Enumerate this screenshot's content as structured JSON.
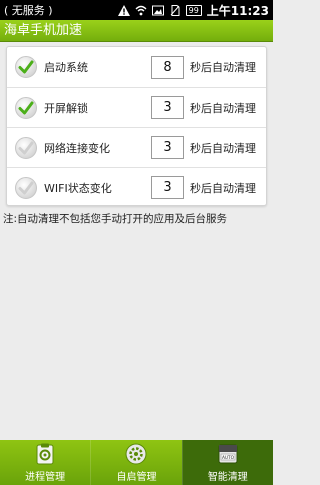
{
  "status_bar": {
    "carrier": "( 无服务 )",
    "battery": "99",
    "time": "上午11:23"
  },
  "title": "海卓手机加速",
  "settings": [
    {
      "label": "启动系统",
      "seconds": "8",
      "suffix": "秒后自动清理",
      "checked": true
    },
    {
      "label": "开屏解锁",
      "seconds": "3",
      "suffix": "秒后自动清理",
      "checked": true
    },
    {
      "label": "网络连接变化",
      "seconds": "3",
      "suffix": "秒后自动清理",
      "checked": false
    },
    {
      "label": "WIFI状态变化",
      "seconds": "3",
      "suffix": "秒后自动清理",
      "checked": false
    }
  ],
  "note": "注:自动清理不包括您手动打开的应用及后台服务",
  "tabs": [
    {
      "label": "进程管理",
      "icon": "process-manager-icon",
      "active": false
    },
    {
      "label": "自启管理",
      "icon": "autostart-gear-icon",
      "active": false
    },
    {
      "label": "智能清理",
      "icon": "auto-clean-icon",
      "active": true
    }
  ],
  "colors": {
    "accent_green": "#7db812",
    "check_green": "#4caf1a",
    "active_tab": "#3d6b0a"
  }
}
